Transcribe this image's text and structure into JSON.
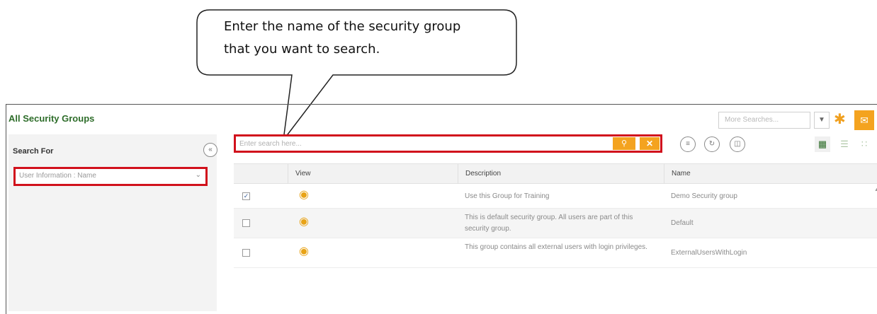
{
  "callout": {
    "text_line1": "Enter the name of the security group",
    "text_line2": "that you want to search."
  },
  "app": {
    "title": "All Security Groups",
    "more_searches_placeholder": "More Searches...",
    "left_panel": {
      "heading": "Search For",
      "field_value": "User Information : Name"
    },
    "search": {
      "placeholder": "Enter search here..."
    },
    "table": {
      "columns": [
        "View",
        "Description",
        "Name"
      ],
      "rows": [
        {
          "checked": true,
          "description": "Use this Group for Training",
          "name": "Demo Security group"
        },
        {
          "checked": false,
          "description": "This is default security group. All users are part of this security group.",
          "name": "Default"
        },
        {
          "checked": false,
          "description": "This group contains all external users with login privileges.",
          "name": "ExternalUsersWithLogin"
        }
      ]
    },
    "icons": {
      "search": "search-icon",
      "clear": "close-icon",
      "collapse": "double-chevron-left-icon",
      "view": "eye-icon",
      "favorite": "star-icon",
      "grid_view": "grid-view-icon",
      "list_view": "list-view-icon",
      "tile_view": "tile-view-icon"
    },
    "colors": {
      "accent": "#f4a31f",
      "title_green": "#2e6d2a",
      "highlight_red": "#d1111c"
    }
  }
}
